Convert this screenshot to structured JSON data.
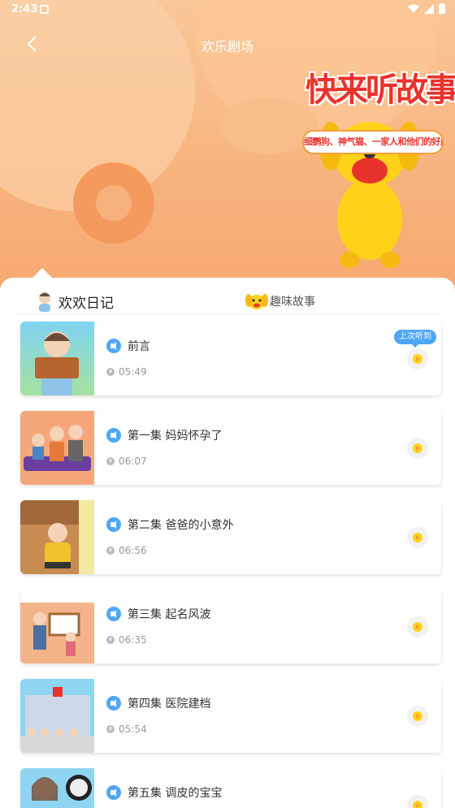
{
  "status_bar": {
    "time": "2:43"
  },
  "header": {
    "title": "欢乐剧场"
  },
  "banner": {
    "headline": "快来听故事啦",
    "subline": "细鹦狗、神气猫、一家人和他们的好朋友"
  },
  "tabs": [
    {
      "label": "欢欢日记",
      "active": true
    },
    {
      "label": "趣味故事",
      "active": false
    }
  ],
  "last_played_badge": "上次听到",
  "episodes": [
    {
      "title": "前言",
      "duration": "05:49",
      "last_played": true
    },
    {
      "title": "第一集 妈妈怀孕了",
      "duration": "06:07",
      "last_played": false
    },
    {
      "title": "第二集 爸爸的小意外",
      "duration": "06:56",
      "last_played": false
    },
    {
      "title": "第三集 起名风波",
      "duration": "06:35",
      "last_played": false
    },
    {
      "title": "第四集 医院建档",
      "duration": "05:54",
      "last_played": false
    },
    {
      "title": "第五集 调皮的宝宝",
      "duration": "",
      "last_played": false
    }
  ],
  "colors": {
    "banner_bg": "#f7b27c",
    "accent_yellow": "#ffd21a",
    "accent_blue": "#4ea6f5",
    "headline_red": "#e8332c"
  }
}
